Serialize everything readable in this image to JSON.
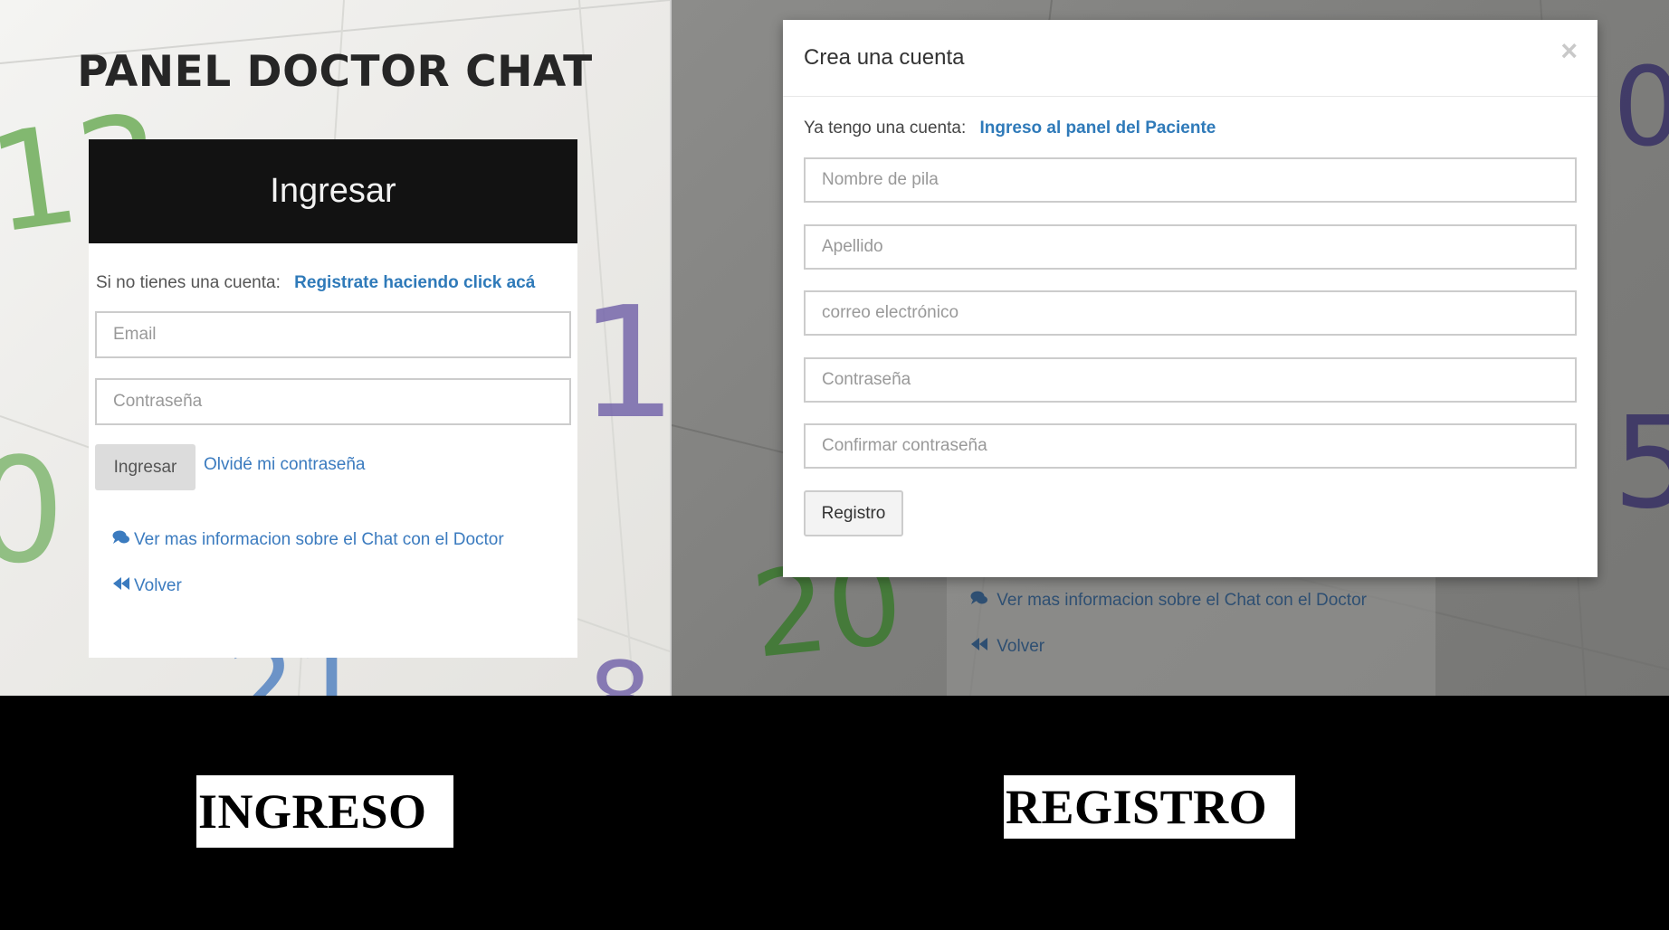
{
  "login_panel": {
    "page_title": "PANEL DOCTOR CHAT",
    "header": "Ingresar",
    "register_prompt": "Si no tienes una cuenta:",
    "register_link": "Registrate haciendo click acá",
    "email_placeholder": "Email",
    "password_placeholder": "Contraseña",
    "login_button": "Ingresar",
    "forgot_link": "Olvidé mi contraseña",
    "info_link": "Ver mas informacion sobre el Chat con el Doctor",
    "back_link": "Volver"
  },
  "register_modal": {
    "title": "Crea una cuenta",
    "close_icon": "close-icon",
    "login_prompt": "Ya tengo una cuenta:",
    "login_link": "Ingreso al panel del Paciente",
    "first_name_placeholder": "Nombre de pila",
    "last_name_placeholder": "Apellido",
    "email_placeholder": "correo electrónico",
    "password_placeholder": "Contraseña",
    "confirm_password_placeholder": "Confirmar contraseña",
    "register_button": "Registro"
  },
  "background_page": {
    "info_link": "Ver mas informacion sobre el Chat con el Doctor",
    "back_link": "Volver"
  },
  "captions": {
    "left": "INGRESO",
    "right": "REGISTRO"
  },
  "icons": {
    "chat": "comments-icon",
    "back": "backward-icon"
  },
  "colors": {
    "link": "#3b7bbf",
    "header_bg": "#121212",
    "modal_bg": "#ffffff"
  }
}
